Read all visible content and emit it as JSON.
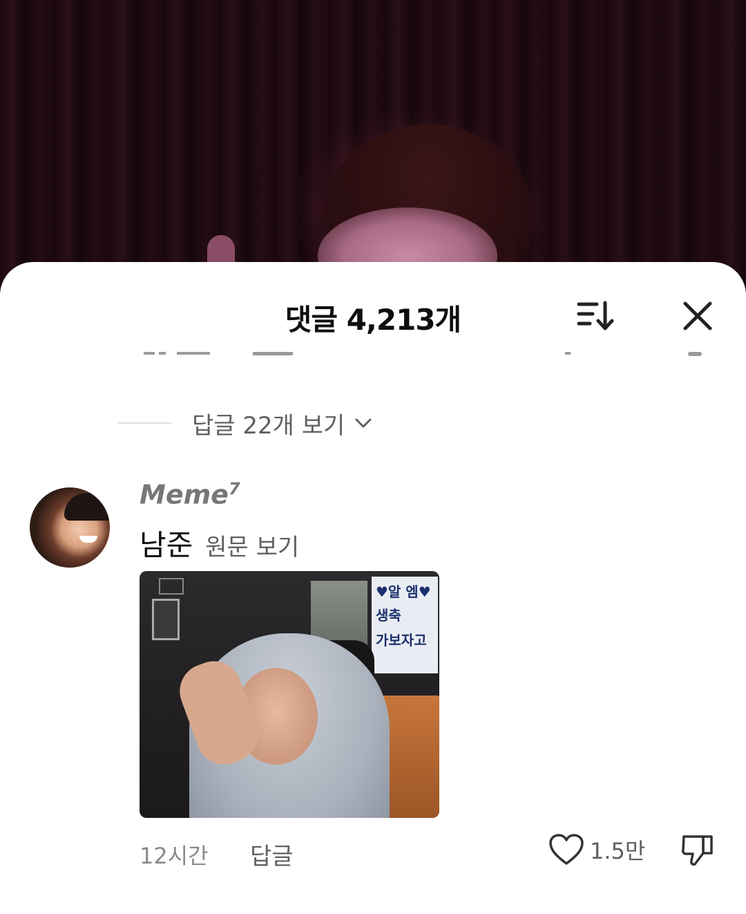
{
  "header": {
    "title": "댓글 4,213개"
  },
  "replies_toggle": {
    "label": "답글 22개 보기"
  },
  "comment": {
    "author": "Meme",
    "author_superscript": "7",
    "text": "남준",
    "translate_label": "원문 보기",
    "image_sign_lines": [
      "♥알 엠♥",
      "생축",
      "가보자고"
    ],
    "time": "12시간",
    "reply_label": "답글",
    "like_count": "1.5만"
  },
  "icons": {
    "sort": "sort-icon",
    "close": "close-icon",
    "chevron": "chevron-down-icon",
    "like": "heart-icon",
    "dislike": "thumbs-down-icon"
  },
  "colors": {
    "title": "#0f0f0f",
    "secondary": "#606060",
    "muted": "#8a8a8a"
  }
}
